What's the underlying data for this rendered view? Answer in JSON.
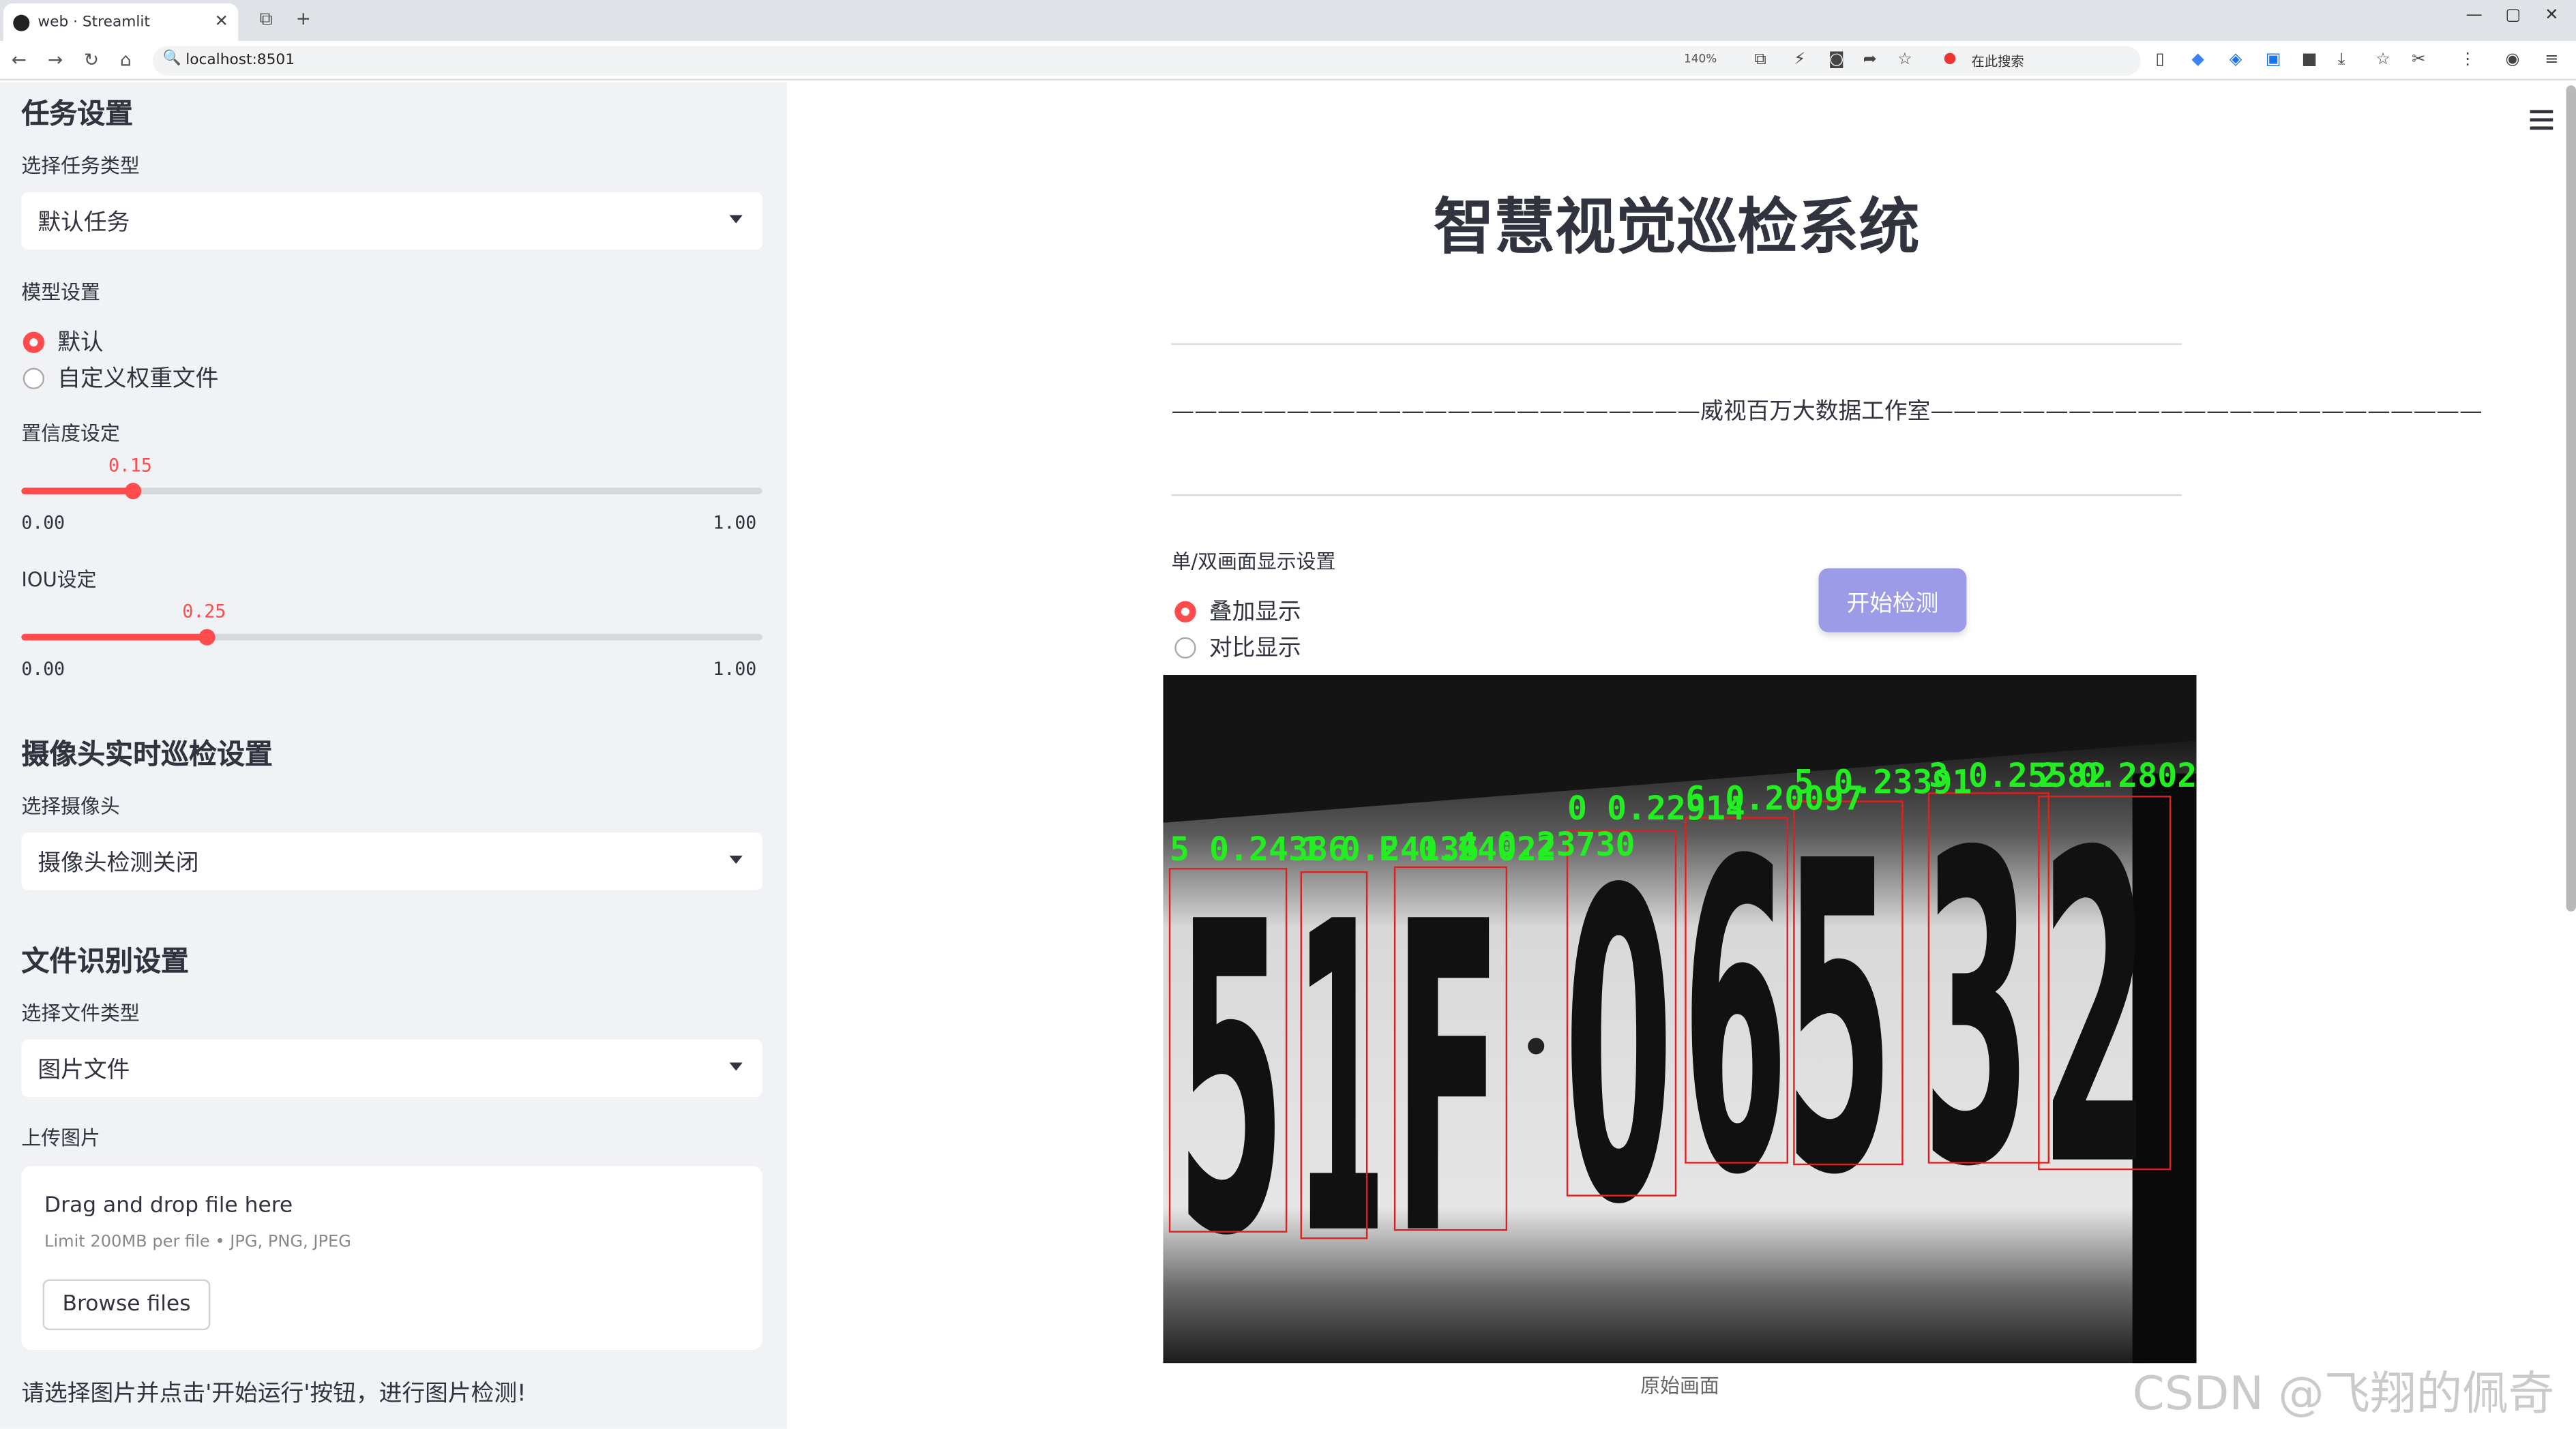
{
  "browser": {
    "tab_title": "web · Streamlit",
    "url": "localhost:8501",
    "zoom": "140%",
    "search_placeholder": "在此搜索"
  },
  "sidebar": {
    "task_heading": "任务设置",
    "task_type_label": "选择任务类型",
    "task_type_value": "默认任务",
    "model_label": "模型设置",
    "model_options": [
      "默认",
      "自定义权重文件"
    ],
    "model_selected": 0,
    "conf_label": "置信度设定",
    "conf_value": "0.15",
    "conf_fraction": 0.15,
    "conf_min": "0.00",
    "conf_max": "1.00",
    "iou_label": "IOU设定",
    "iou_value": "0.25",
    "iou_fraction": 0.25,
    "iou_min": "0.00",
    "iou_max": "1.00",
    "camera_heading": "摄像头实时巡检设置",
    "camera_label": "选择摄像头",
    "camera_value": "摄像头检测关闭",
    "file_heading": "文件识别设置",
    "file_type_label": "选择文件类型",
    "file_type_value": "图片文件",
    "upload_label": "上传图片",
    "upload_drag": "Drag and drop file here",
    "upload_limit": "Limit 200MB per file • JPG, PNG, JPEG",
    "browse_button": "Browse files",
    "note": "请选择图片并点击'开始运行'按钮，进行图片检测!"
  },
  "main": {
    "title": "智慧视觉巡检系统",
    "studio": "———————————————————————威视百万大数据工作室————————————————————————",
    "display_label": "单/双画面显示设置",
    "display_options": [
      "叠加显示",
      "对比显示"
    ],
    "display_selected": 0,
    "start_button": "开始检测",
    "image_caption": "原始画面",
    "plate_chars": [
      "5",
      "1",
      "F",
      "0",
      "6",
      "5",
      "3",
      "2"
    ],
    "detections": [
      "5 0.24386",
      "1 0.24136",
      "F 0.24022",
      "4 0.23730",
      "0 0.22914",
      "6 0.20097",
      "5 0.23391",
      "3 0.25582",
      "2 0.2802"
    ]
  },
  "watermark": "CSDN @飞翔的佩奇"
}
